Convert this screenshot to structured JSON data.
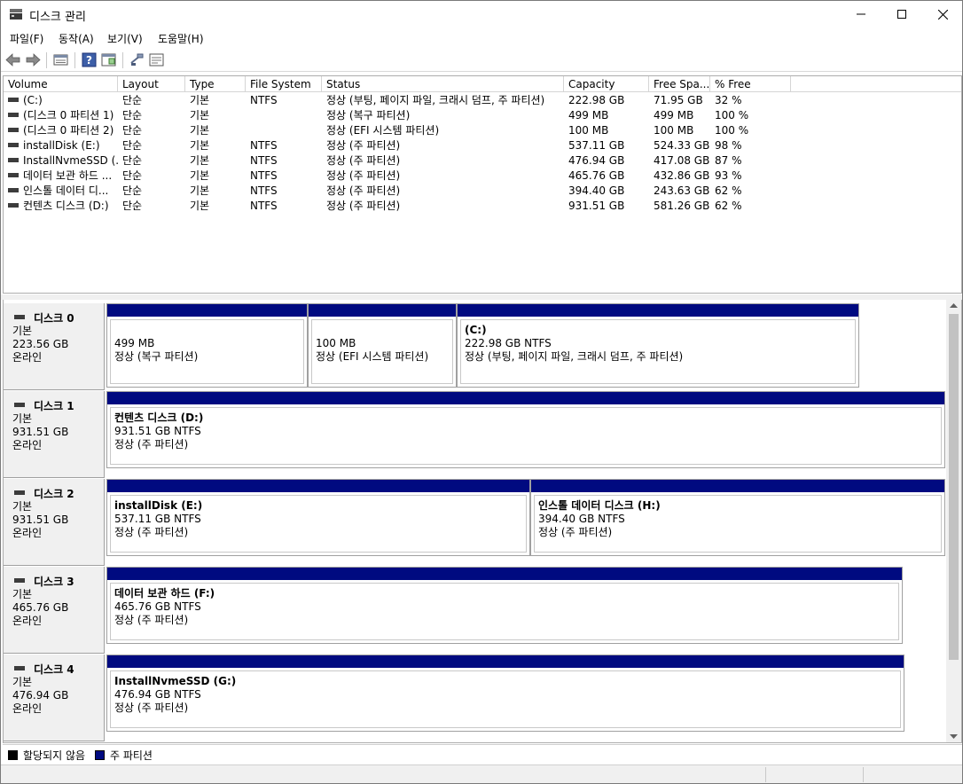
{
  "window": {
    "title": "디스크 관리"
  },
  "menu": [
    "파일(F)",
    "동작(A)",
    "보기(V)",
    "도움말(H)"
  ],
  "toolbar": {
    "icons": [
      "back-arrow-icon",
      "forward-arrow-icon",
      "disk-list-icon",
      "help-icon",
      "properties-icon",
      "rescan-icon",
      "volume-list-icon"
    ]
  },
  "volume_list": {
    "columns": [
      "Volume",
      "Layout",
      "Type",
      "File System",
      "Status",
      "Capacity",
      "Free Spa...",
      "% Free"
    ],
    "rows": [
      {
        "volume": "(C:)",
        "layout": "단순",
        "type": "기본",
        "fs": "NTFS",
        "status": "정상 (부팅, 페이지 파일, 크래시 덤프, 주 파티션)",
        "capacity": "222.98 GB",
        "free": "71.95 GB",
        "pct": "32 %"
      },
      {
        "volume": "(디스크 0 파티션 1)",
        "layout": "단순",
        "type": "기본",
        "fs": "",
        "status": "정상 (복구 파티션)",
        "capacity": "499 MB",
        "free": "499 MB",
        "pct": "100 %"
      },
      {
        "volume": "(디스크 0 파티션 2)",
        "layout": "단순",
        "type": "기본",
        "fs": "",
        "status": "정상 (EFI 시스템 파티션)",
        "capacity": "100 MB",
        "free": "100 MB",
        "pct": "100 %"
      },
      {
        "volume": "installDisk (E:)",
        "layout": "단순",
        "type": "기본",
        "fs": "NTFS",
        "status": "정상 (주 파티션)",
        "capacity": "537.11 GB",
        "free": "524.33 GB",
        "pct": "98 %"
      },
      {
        "volume": "InstallNvmeSSD (...",
        "layout": "단순",
        "type": "기본",
        "fs": "NTFS",
        "status": "정상 (주 파티션)",
        "capacity": "476.94 GB",
        "free": "417.08 GB",
        "pct": "87 %"
      },
      {
        "volume": "데이터 보관 하드 ...",
        "layout": "단순",
        "type": "기본",
        "fs": "NTFS",
        "status": "정상 (주 파티션)",
        "capacity": "465.76 GB",
        "free": "432.86 GB",
        "pct": "93 %"
      },
      {
        "volume": "인스톨 데이터 디...",
        "layout": "단순",
        "type": "기본",
        "fs": "NTFS",
        "status": "정상 (주 파티션)",
        "capacity": "394.40 GB",
        "free": "243.63 GB",
        "pct": "62 %"
      },
      {
        "volume": "컨텐츠 디스크 (D:)",
        "layout": "단순",
        "type": "기본",
        "fs": "NTFS",
        "status": "정상 (주 파티션)",
        "capacity": "931.51 GB",
        "free": "581.26 GB",
        "pct": "62 %"
      }
    ]
  },
  "disks": [
    {
      "name": "디스크 0",
      "type": "기본",
      "size": "223.56 GB",
      "state": "온라인",
      "partitions": [
        {
          "name": "",
          "size": "499 MB",
          "status": "정상 (복구 파티션)"
        },
        {
          "name": "",
          "size": "100 MB",
          "status": "정상 (EFI 시스템 파티션)"
        },
        {
          "name": "(C:)",
          "size": "222.98 GB NTFS",
          "status": "정상 (부팅, 페이지 파일, 크래시 덤프, 주 파티션)"
        }
      ]
    },
    {
      "name": "디스크 1",
      "type": "기본",
      "size": "931.51 GB",
      "state": "온라인",
      "partitions": [
        {
          "name": "컨텐츠 디스크  (D:)",
          "size": "931.51 GB NTFS",
          "status": "정상 (주 파티션)"
        }
      ]
    },
    {
      "name": "디스크 2",
      "type": "기본",
      "size": "931.51 GB",
      "state": "온라인",
      "partitions": [
        {
          "name": "installDisk  (E:)",
          "size": "537.11 GB NTFS",
          "status": "정상 (주 파티션)"
        },
        {
          "name": "인스톨 데이터 디스크  (H:)",
          "size": "394.40 GB NTFS",
          "status": "정상 (주 파티션)"
        }
      ]
    },
    {
      "name": "디스크 3",
      "type": "기본",
      "size": "465.76 GB",
      "state": "온라인",
      "partitions": [
        {
          "name": "데이터 보관 하드  (F:)",
          "size": "465.76 GB NTFS",
          "status": "정상 (주 파티션)"
        }
      ]
    },
    {
      "name": "디스크 4",
      "type": "기본",
      "size": "476.94 GB",
      "state": "온라인",
      "partitions": [
        {
          "name": "InstallNvmeSSD  (G:)",
          "size": "476.94 GB NTFS",
          "status": "정상 (주 파티션)"
        }
      ]
    }
  ],
  "legend": [
    {
      "label": "할당되지 않음",
      "color": "#000000"
    },
    {
      "label": "주 파티션",
      "color": "#000a80"
    }
  ]
}
